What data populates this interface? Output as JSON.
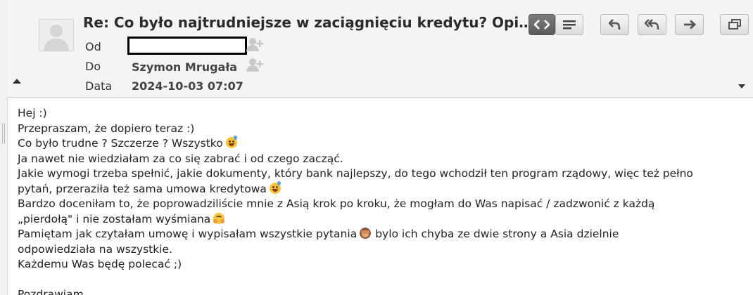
{
  "message": {
    "subject": "Re: Co było najtrudniejsze w zaciągnięciu kredytu? Opinie klientów",
    "from_label": "Od",
    "to_label": "Do",
    "date_label": "Data",
    "to_value": "Szymon Mrugała",
    "date_value": "2024-10-03 07:07"
  },
  "toolbar": {
    "icons": [
      "code-view-icon",
      "plain-text-view-icon",
      "reply-icon",
      "reply-all-icon",
      "forward-icon",
      "open-window-icon"
    ]
  },
  "body": {
    "line1": "Hej :)",
    "line2": "Przepraszam, że dopiero teraz :)",
    "line3": "Co było trudne ? Szczerze ? Wszystko",
    "line4": "Ja nawet nie wiedziałam za co się zabrać i od czego zacząć.",
    "line5": "Jakie wymogi trzeba spełnić, jakie dokumenty, który bank najlepszy, do tego wchodził ten program rządowy, więc też pełno",
    "line6": "pytań, przeraziła też sama umowa kredytowa",
    "line7": "Bardzo doceniłam to, że poprowadziliście mnie z Asią krok po kroku, że mogłam do Was napisać / zadzwonić z każdą",
    "line8": "„pierdołą\" i nie zostałam wyśmiana",
    "line9a": "Pamiętam jak czytałam umowę i wypisałam wszystkie pytania",
    "line9b": "bylo ich chyba ze dwie strony a Asia dzielnie",
    "line10": "odpowiedziała na wszystkie.",
    "line11": "Każdemu Was będę polecać ;)",
    "line12": "Pozdrawiam,"
  },
  "colors": {
    "header_bg": "#f4f4f4",
    "active_button": "#5a5a5a",
    "text": "#222222"
  }
}
